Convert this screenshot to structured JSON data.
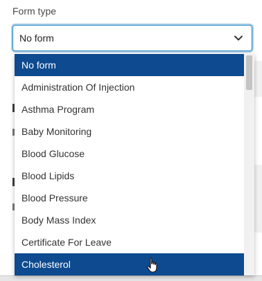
{
  "form_type": {
    "label": "Form type",
    "selected_value": "No form",
    "icons": {
      "chevron": "chevron-down-icon"
    }
  },
  "dropdown": {
    "options": [
      {
        "label": "No form",
        "state": "selected"
      },
      {
        "label": "Administration Of Injection",
        "state": "normal"
      },
      {
        "label": "Asthma Program",
        "state": "normal"
      },
      {
        "label": "Baby Monitoring",
        "state": "normal"
      },
      {
        "label": "Blood Glucose",
        "state": "normal"
      },
      {
        "label": "Blood Lipids",
        "state": "normal"
      },
      {
        "label": "Blood Pressure",
        "state": "normal"
      },
      {
        "label": "Body Mass Index",
        "state": "normal"
      },
      {
        "label": "Certificate For Leave",
        "state": "normal"
      },
      {
        "label": "Cholesterol",
        "state": "hovered"
      }
    ],
    "highlight_color": "#0d4a90"
  },
  "colors": {
    "focus_border": "#2a87c6",
    "text": "#333333"
  },
  "cursor": {
    "icon": "hand-pointer-icon"
  }
}
